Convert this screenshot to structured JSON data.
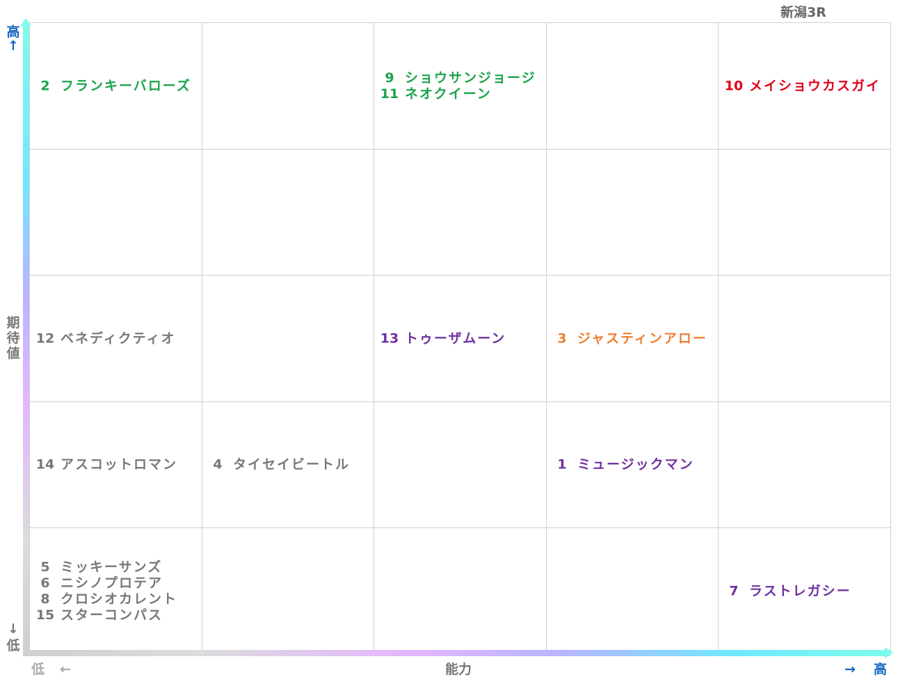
{
  "title": "新潟3R",
  "y_axis": {
    "high_label": "高",
    "high_arrow": "↑",
    "name": "期待値",
    "low_arrow": "↓",
    "low_label": "低"
  },
  "x_axis": {
    "low_label": "低",
    "low_arrow": "←",
    "name": "能力",
    "high_arrow": "→",
    "high_label": "高"
  },
  "colors": {
    "blue": "#1565c0",
    "gray": "#777777",
    "green": "#19a34a",
    "red": "#e0001a",
    "purple": "#7030a0",
    "orange": "#ed7d31",
    "grid": "#cfcfcf"
  },
  "chart_data": {
    "type": "table",
    "columns": 5,
    "rows": 5,
    "x_order": "能力 low → high (left → right)",
    "y_order": "期待値 high → low (top → bottom)",
    "cells": [
      {
        "row": 0,
        "col": 0,
        "color": "#19a34a",
        "entries": [
          {
            "num": "2",
            "name": "フランキーバローズ"
          }
        ]
      },
      {
        "row": 0,
        "col": 2,
        "color": "#19a34a",
        "entries": [
          {
            "num": "9",
            "name": "ショウサンジョージ"
          },
          {
            "num": "11",
            "name": "ネオクイーン"
          }
        ]
      },
      {
        "row": 0,
        "col": 4,
        "color": "#e0001a",
        "entries": [
          {
            "num": "10",
            "name": "メイショウカスガイ"
          }
        ]
      },
      {
        "row": 2,
        "col": 0,
        "color": "#777777",
        "entries": [
          {
            "num": "12",
            "name": "ベネディクティオ"
          }
        ]
      },
      {
        "row": 2,
        "col": 2,
        "color": "#7030a0",
        "entries": [
          {
            "num": "13",
            "name": "トゥーザムーン"
          }
        ]
      },
      {
        "row": 2,
        "col": 3,
        "color": "#ed7d31",
        "entries": [
          {
            "num": "3",
            "name": "ジャスティンアロー"
          }
        ]
      },
      {
        "row": 3,
        "col": 0,
        "color": "#777777",
        "entries": [
          {
            "num": "14",
            "name": "アスコットロマン"
          }
        ]
      },
      {
        "row": 3,
        "col": 1,
        "color": "#777777",
        "entries": [
          {
            "num": "4",
            "name": "タイセイビートル"
          }
        ]
      },
      {
        "row": 3,
        "col": 3,
        "color": "#7030a0",
        "entries": [
          {
            "num": "1",
            "name": "ミュージックマン"
          }
        ]
      },
      {
        "row": 4,
        "col": 0,
        "color": "#777777",
        "entries": [
          {
            "num": "5",
            "name": "ミッキーサンズ"
          },
          {
            "num": "6",
            "name": "ニシノプロテア"
          },
          {
            "num": "8",
            "name": "クロシオカレント"
          },
          {
            "num": "15",
            "name": "スターコンパス"
          }
        ]
      },
      {
        "row": 4,
        "col": 4,
        "color": "#7030a0",
        "entries": [
          {
            "num": "7",
            "name": "ラストレガシー"
          }
        ]
      }
    ]
  }
}
